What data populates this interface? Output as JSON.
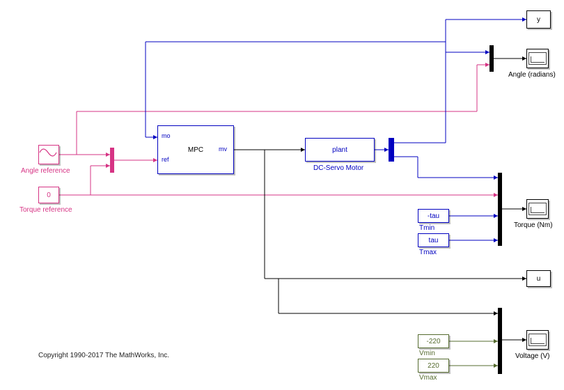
{
  "sources": {
    "angle_ref_label": "Angle reference",
    "torque_ref_label": "Torque reference",
    "torque_ref_value": "0"
  },
  "mpc": {
    "title": "MPC",
    "port_mo": "mo",
    "port_ref": "ref",
    "port_mv": "mv"
  },
  "plant": {
    "title": "plant",
    "label": "DC-Servo Motor"
  },
  "torque_limits": {
    "min_value": "-tau",
    "min_label": "Tmin",
    "max_value": "tau",
    "max_label": "Tmax"
  },
  "voltage_limits": {
    "min_value": "-220",
    "min_label": "Vmin",
    "max_value": "220",
    "max_label": "Vmax"
  },
  "sinks": {
    "y_label": "y",
    "u_label": "u",
    "angle_scope_label": "Angle (radians)",
    "torque_scope_label": "Torque (Nm)",
    "voltage_scope_label": "Voltage (V)"
  },
  "copyright": "Copyright 1990-2017 The MathWorks, Inc."
}
